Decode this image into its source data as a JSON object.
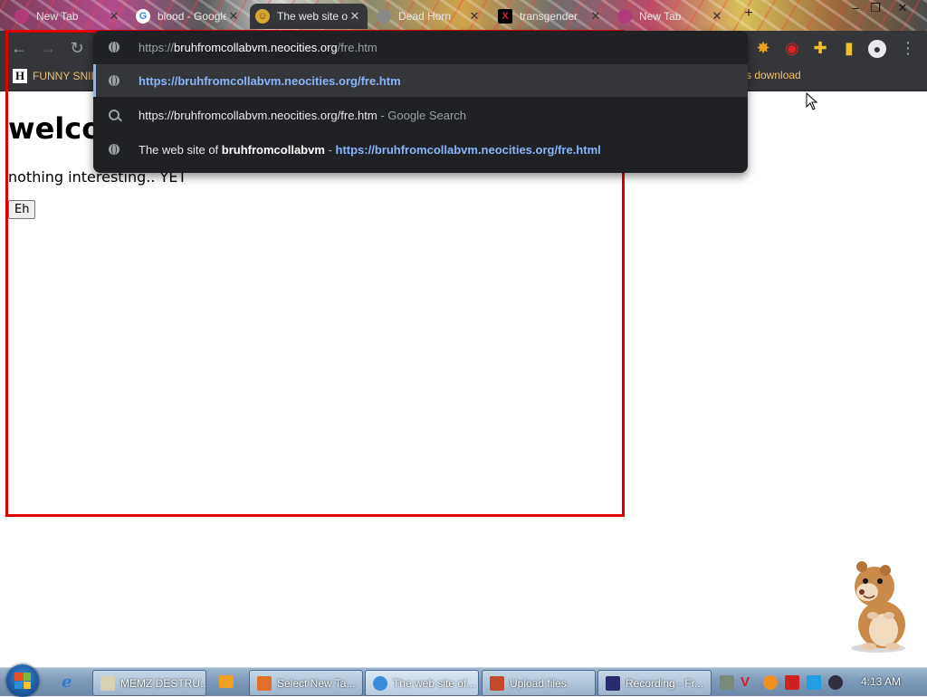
{
  "tabs": [
    {
      "title": "New Tab",
      "icon": "chrome-icon",
      "active": false
    },
    {
      "title": "blood - Google Search",
      "icon": "google-icon",
      "active": false
    },
    {
      "title": "The web site of bruhfromcollabvm",
      "icon": "neocities-icon",
      "active": true
    },
    {
      "title": "Dead Horn",
      "icon": "page-icon",
      "active": false
    },
    {
      "title": "transgender",
      "icon": "x-icon",
      "active": false
    },
    {
      "title": "New Tab",
      "icon": "chrome-icon",
      "active": false
    }
  ],
  "address_bar": {
    "scheme": "https://",
    "host": "bruhfromcollabvm.neocities.org",
    "path": "/fre.htm"
  },
  "omnibox": {
    "suggestions": [
      {
        "type": "url",
        "text": "https://bruhfromcollabvm.neocities.org/fre.htm"
      },
      {
        "type": "search",
        "text": "https://bruhfromcollabvm.neocities.org/fre.htm",
        "suffix": "- Google Search"
      },
      {
        "type": "history",
        "prefix": "The web site of",
        "bold": "bruhfromcollabvm",
        "separator": "-",
        "link": "https://bruhfromcollabvm.neocities.org/fre.html"
      }
    ]
  },
  "bookmarks": {
    "first": "FUNNY SNIP",
    "right": "s download"
  },
  "page": {
    "heading": "welco",
    "paragraph": "nothing interesting.. YET",
    "button": "Eh"
  },
  "taskbar": {
    "buttons": [
      {
        "label": "MEMZ DESTRU...",
        "icon_color": "#d8d0b0"
      },
      {
        "label": "Select New Ta...",
        "icon_color": "#e0702a"
      },
      {
        "label": "The web site of...",
        "icon_color": "#3a8bd8",
        "active": true
      },
      {
        "label": "Upload files",
        "icon_color": "#c04a2a"
      },
      {
        "label": "Recording - Fr...",
        "icon_color": "#2a2a70"
      }
    ],
    "clock": "4:13 AM"
  },
  "colors": {
    "annotation_box": "#e00000",
    "omnibox_link": "#8ab4f8",
    "bookmark_text": "#f0c070"
  }
}
